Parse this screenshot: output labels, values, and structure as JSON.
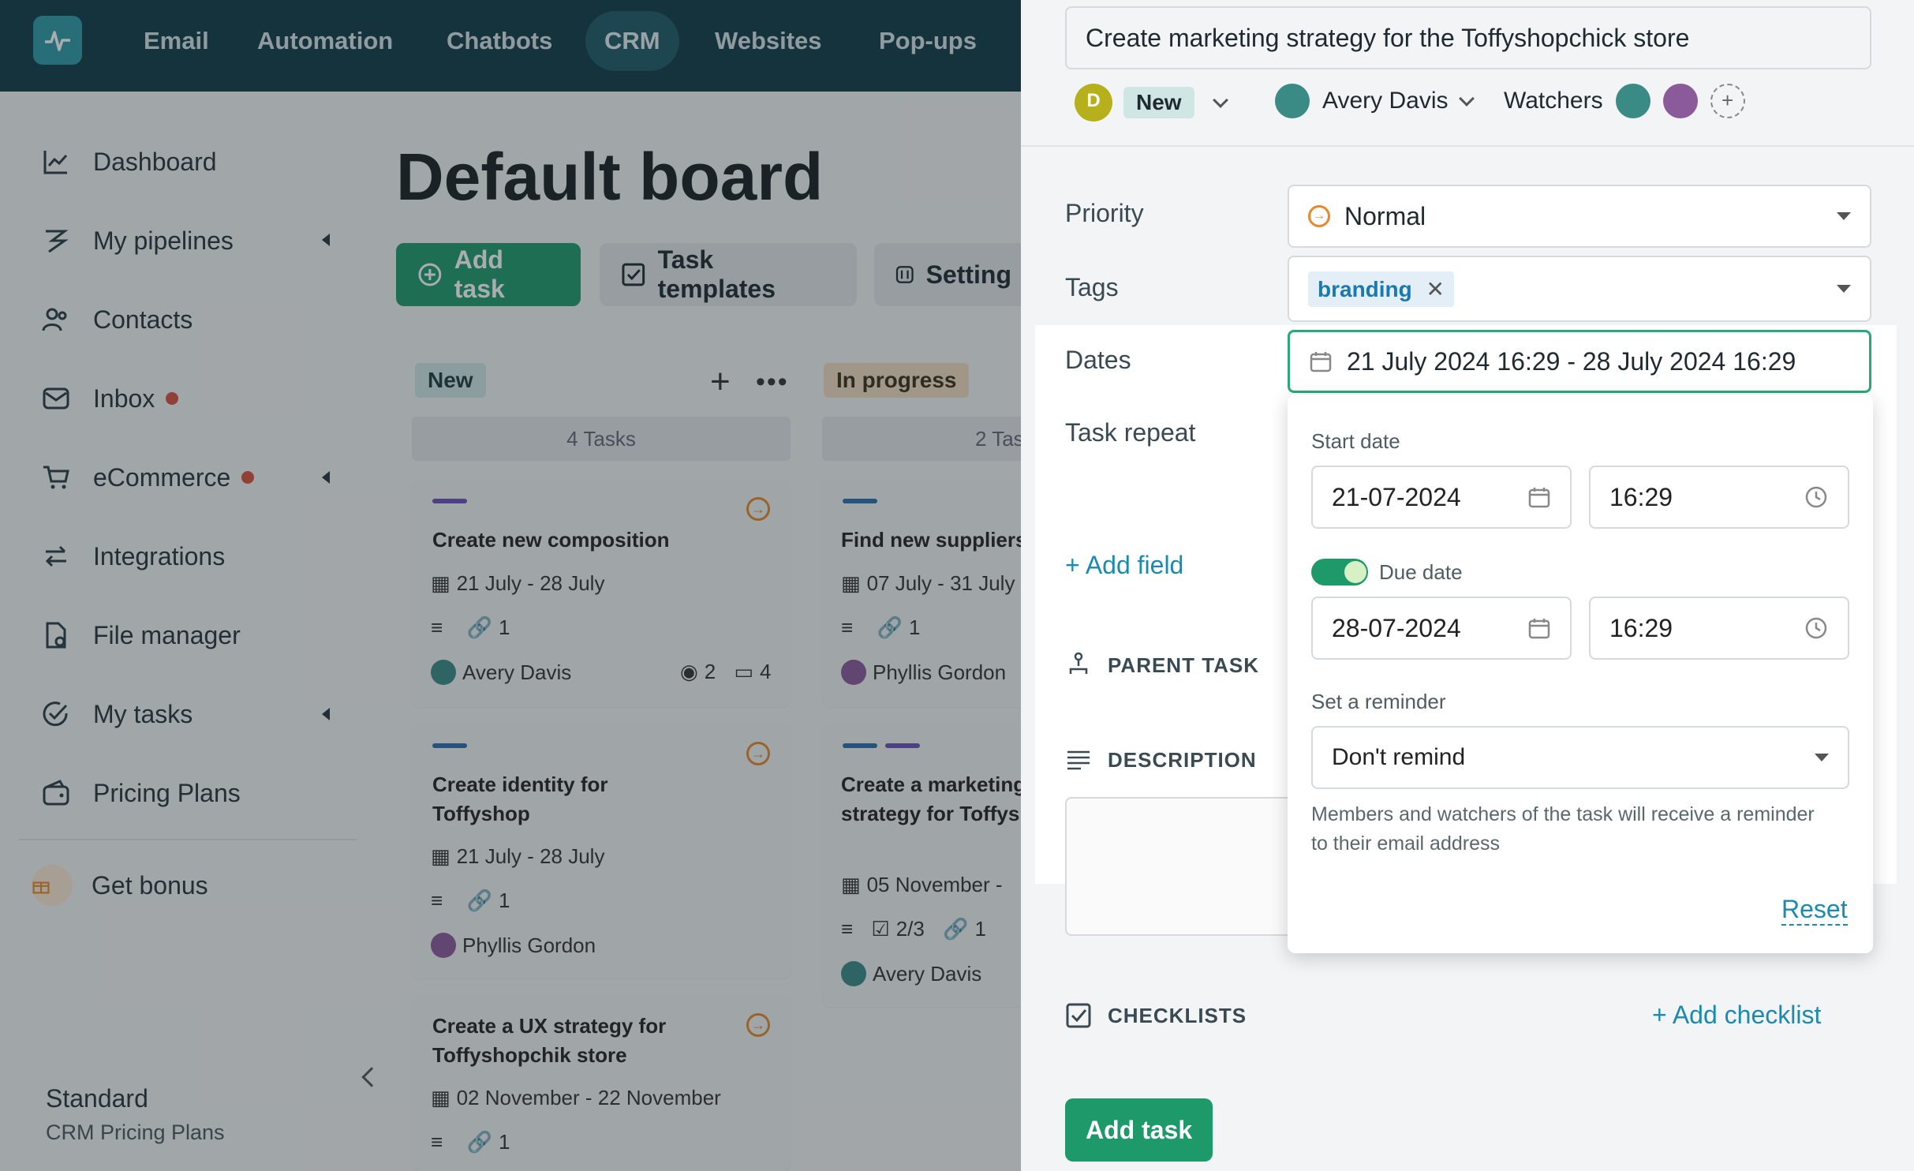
{
  "nav": {
    "items": [
      {
        "label": "Email"
      },
      {
        "label": "Automation"
      },
      {
        "label": "Chatbots"
      },
      {
        "label": "CRM"
      },
      {
        "label": "Websites"
      },
      {
        "label": "Pop-ups"
      }
    ],
    "active": "CRM"
  },
  "sidebar": {
    "items": [
      {
        "label": "Dashboard",
        "icon": "chart-line-icon"
      },
      {
        "label": "My pipelines",
        "icon": "pipeline-icon"
      },
      {
        "label": "Contacts",
        "icon": "contacts-icon"
      },
      {
        "label": "Inbox",
        "icon": "inbox-icon"
      },
      {
        "label": "eCommerce",
        "icon": "cart-icon"
      },
      {
        "label": "Integrations",
        "icon": "arrows-icon"
      },
      {
        "label": "File manager",
        "icon": "file-icon"
      },
      {
        "label": "My tasks",
        "icon": "check-circle-icon"
      },
      {
        "label": "Pricing Plans",
        "icon": "wallet-icon"
      }
    ],
    "bonus": "Get bonus",
    "plan_name": "Standard",
    "plan_sub": "CRM Pricing Plans"
  },
  "board": {
    "title": "Default board",
    "add_task": "Add task",
    "task_templates": "Task templates",
    "settings": "Setting",
    "columns": [
      {
        "name": "New",
        "count": "4 Tasks",
        "cards": [
          {
            "title": "Create new composition",
            "dates": "21 July  -  28 July",
            "links": "1",
            "assignee": "Avery Davis",
            "views": "2",
            "comments": "4"
          },
          {
            "title": "Create identity for Toffyshop",
            "dates": "21 July  -  28 July",
            "links": "1",
            "assignee": "Phyllis Gordon"
          },
          {
            "title": "Create a UX strategy for Toffyshopchik store",
            "dates": "02 November  -  22 November",
            "links": "1"
          }
        ]
      },
      {
        "name": "In progress",
        "count": "2 Tas",
        "cards": [
          {
            "title": "Find new suppliers",
            "dates": "07 July  -  31 July",
            "links": "1",
            "assignee": "Phyllis Gordon"
          },
          {
            "title": "Create a marketing strategy for Toffys store",
            "dates": "05 November  -",
            "checks": "2/3",
            "links": "1",
            "assignee": "Avery Davis"
          }
        ]
      }
    ]
  },
  "panel": {
    "task_title": "Create marketing strategy for the Toffyshopchick store",
    "status_initial": "D",
    "status": "New",
    "assignee": "Avery Davis",
    "watchers": "Watchers",
    "priority_label": "Priority",
    "priority_value": "Normal",
    "tags_label": "Tags",
    "tag": "branding",
    "dates_label": "Dates",
    "dates_value": "21 July 2024 16:29 - 28 July 2024 16:29",
    "repeat_label": "Task repeat",
    "add_field": "+ Add field",
    "parent_task": "PARENT TASK",
    "description": "DESCRIPTION",
    "checklists": "CHECKLISTS",
    "add_checklist": "+ Add checklist",
    "submit": "Add task"
  },
  "dates_popup": {
    "start_label": "Start date",
    "start_date": "21-07-2024",
    "start_time": "16:29",
    "due_label": "Due date",
    "due_date": "28-07-2024",
    "due_time": "16:29",
    "reminder_label": "Set a reminder",
    "reminder_value": "Don't remind",
    "hint": "Members and watchers of the task will receive a reminder to their email address",
    "reset": "Reset"
  },
  "colors": {
    "primary": "#1e9a6a",
    "nav_bg": "#0f3a48",
    "link": "#1a8bb0",
    "accent_orange": "#e58a2c"
  }
}
